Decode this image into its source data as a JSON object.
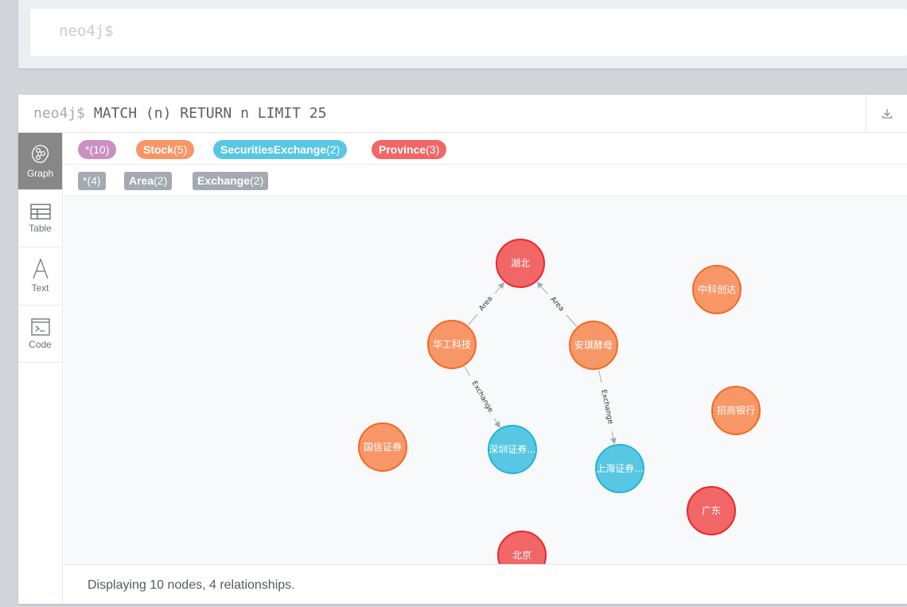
{
  "editor": {
    "prompt": "neo4j$"
  },
  "frame": {
    "prompt": "neo4j$",
    "query": "MATCH (n) RETURN n LIMIT 25",
    "download_icon": "download-icon"
  },
  "sidebar": {
    "tabs": [
      {
        "label": "Graph",
        "icon": "graph-icon",
        "active": true
      },
      {
        "label": "Table",
        "icon": "table-icon",
        "active": false
      },
      {
        "label": "Text",
        "icon": "text-icon",
        "active": false
      },
      {
        "label": "Code",
        "icon": "code-icon",
        "active": false
      }
    ]
  },
  "legend": {
    "labels": [
      {
        "name": "*",
        "count": "(10)",
        "color": "#c990c0"
      },
      {
        "name": "Stock",
        "count": "(5)",
        "color": "#f79767"
      },
      {
        "name": "SecuritiesExchange",
        "count": "(2)",
        "color": "#57c7e3"
      },
      {
        "name": "Province",
        "count": "(3)",
        "color": "#f16667"
      }
    ],
    "relationships": [
      {
        "name": "*",
        "count": "(4)"
      },
      {
        "name": "Area",
        "count": "(2)"
      },
      {
        "name": "Exchange",
        "count": "(2)"
      }
    ]
  },
  "graph": {
    "nodes": [
      {
        "id": "hubei",
        "label": "湖北",
        "type": "Province"
      },
      {
        "id": "hgkj",
        "label": "华工科技",
        "type": "Stock"
      },
      {
        "id": "aqjm",
        "label": "安琪酵母",
        "type": "Stock"
      },
      {
        "id": "zkcd",
        "label": "中科创达",
        "type": "Stock"
      },
      {
        "id": "zsyh",
        "label": "招商银行",
        "type": "Stock"
      },
      {
        "id": "gxzq",
        "label": "国信证券",
        "type": "Stock"
      },
      {
        "id": "szse",
        "label": "深圳证券...",
        "type": "SecuritiesExchange"
      },
      {
        "id": "shse",
        "label": "上海证券...",
        "type": "SecuritiesExchange"
      },
      {
        "id": "gd",
        "label": "广东",
        "type": "Province"
      },
      {
        "id": "bj",
        "label": "北京",
        "type": "Province"
      }
    ],
    "relationships": [
      {
        "from": "hgkj",
        "to": "hubei",
        "type": "Area"
      },
      {
        "from": "aqjm",
        "to": "hubei",
        "type": "Area"
      },
      {
        "from": "hgkj",
        "to": "szse",
        "type": "Exchange"
      },
      {
        "from": "aqjm",
        "to": "shse",
        "type": "Exchange"
      }
    ],
    "type_colors": {
      "Province": {
        "fill": "#f16667",
        "stroke": "#eb2728"
      },
      "Stock": {
        "fill": "#f79767",
        "stroke": "#f36924"
      },
      "SecuritiesExchange": {
        "fill": "#57c7e3",
        "stroke": "#23b3d7"
      }
    }
  },
  "status": {
    "text": "Displaying 10 nodes, 4 relationships."
  }
}
